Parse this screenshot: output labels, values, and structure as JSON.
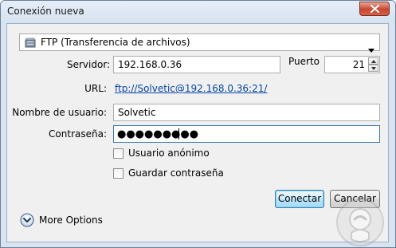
{
  "window": {
    "title": "Conexión nueva"
  },
  "connection_type": {
    "selected": "FTP (Transferencia de archivos)",
    "icon": "ftp-drive-icon"
  },
  "form": {
    "server_label": "Servidor:",
    "server_value": "192.168.0.36",
    "port_label": "Puerto",
    "port_value": "21",
    "url_label": "URL:",
    "url_value": "ftp://Solvetic@192.168.0.36:21/",
    "username_label": "Nombre de usuario:",
    "username_value": "Solvetic",
    "password_label": "Contraseña:",
    "password_value": "●●●●●●●●●"
  },
  "options": {
    "anonymous_label": "Usuario anónimo",
    "anonymous_checked": false,
    "save_password_label": "Guardar contraseña",
    "save_password_checked": false
  },
  "buttons": {
    "connect": "Conectar",
    "cancel": "Cancelar"
  },
  "more_options": {
    "label": "More Options",
    "icon": "chevron-down-circle-icon"
  },
  "colors": {
    "link": "#0645ad",
    "focus_border": "#3d7bad",
    "close_button": "#c7472f"
  }
}
